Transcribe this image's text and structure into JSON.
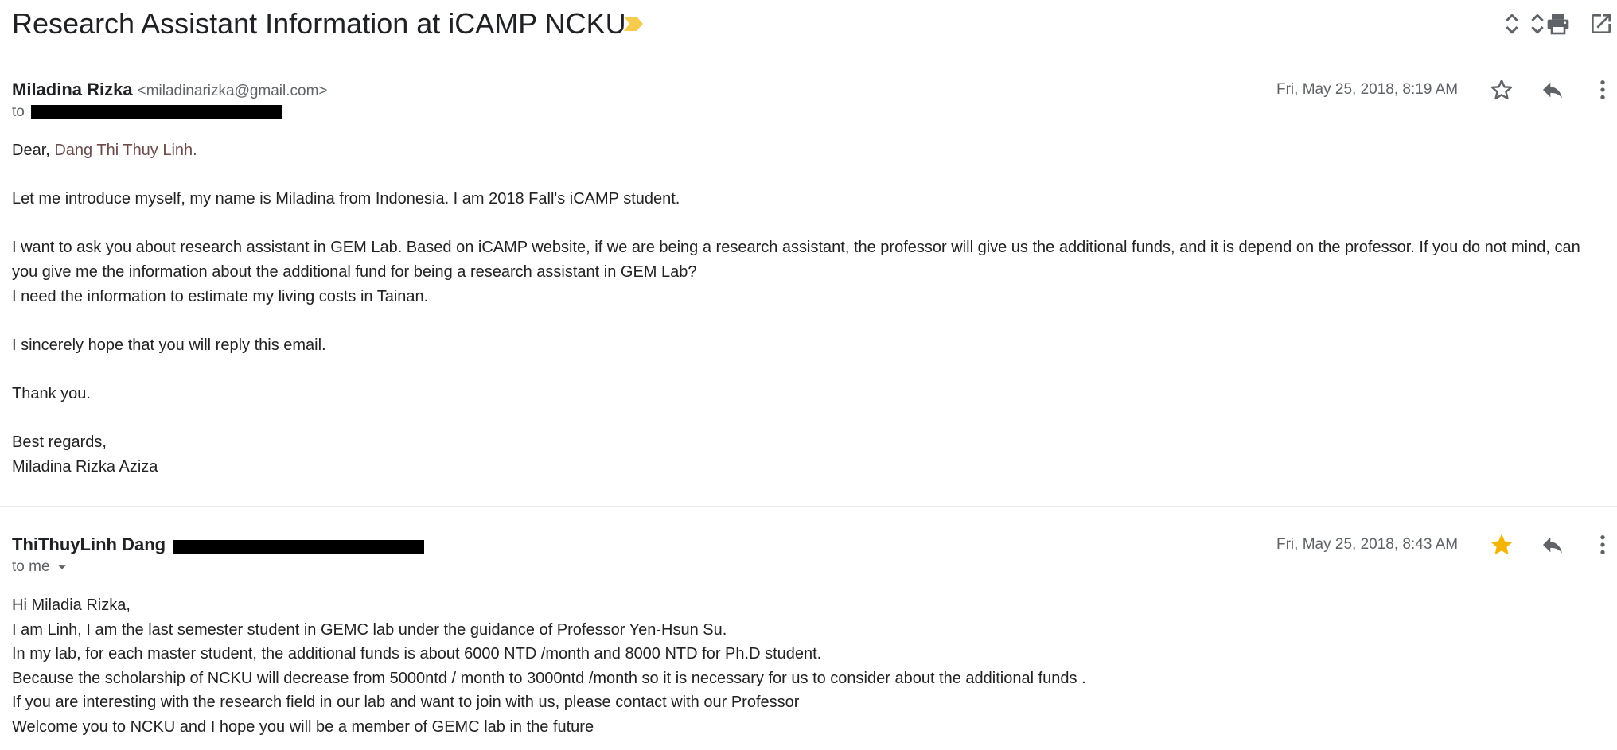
{
  "thread": {
    "subject": "Research Assistant Information at iCAMP NCKU",
    "colors": {
      "important_marker": "#f7cb4d",
      "icon_gray": "#5f6368",
      "star_filled": "#f4b400"
    }
  },
  "messages": [
    {
      "sender_name": "Miladina Rizka",
      "sender_email": "<miladinarizka@gmail.com>",
      "to_label": "to",
      "date": "Fri, May 25, 2018, 8:19 AM",
      "starred": false,
      "body": {
        "greeting_prefix": "Dear, ",
        "greeting_name": "Dang Thi Thuy Linh.",
        "p1": "Let me introduce myself, my name is Miladina from Indonesia. I am 2018 Fall's iCAMP student.",
        "p2": "I want to ask you about research assistant in GEM Lab. Based on iCAMP website, if we are being a research assistant, the professor will give us the additional funds, and it is depend on the professor. If you do not mind, can you give me the information about the additional fund for being a research assistant in GEM Lab?",
        "p3": "I need the information to estimate my living costs in Tainan.",
        "p4": "I sincerely hope that you will reply this email.",
        "p5": "Thank you.",
        "p6": "Best regards,",
        "p7": "Miladina Rizka Aziza"
      }
    },
    {
      "sender_name": "ThiThuyLinh Dang",
      "to_label": "to me",
      "date": "Fri, May 25, 2018, 8:43 AM",
      "starred": true,
      "body": {
        "l1": "Hi Miladia Rizka,",
        "l2": "I am Linh, I am the last semester student in GEMC lab under the guidance of Professor Yen-Hsun Su.",
        "l3": "In my lab, for each master student, the additional funds is about 6000 NTD /month and 8000 NTD for Ph.D student.",
        "l4": "Because the scholarship of NCKU will decrease from 5000ntd / month to 3000ntd /month so it is necessary for us to consider about the additional funds .",
        "l5": "If you are interesting with the research field in our lab and want to join with us, please contact with our Professor",
        "l6": "Welcome you to NCKU and I hope you will be a member of GEMC lab in the future"
      }
    }
  ]
}
